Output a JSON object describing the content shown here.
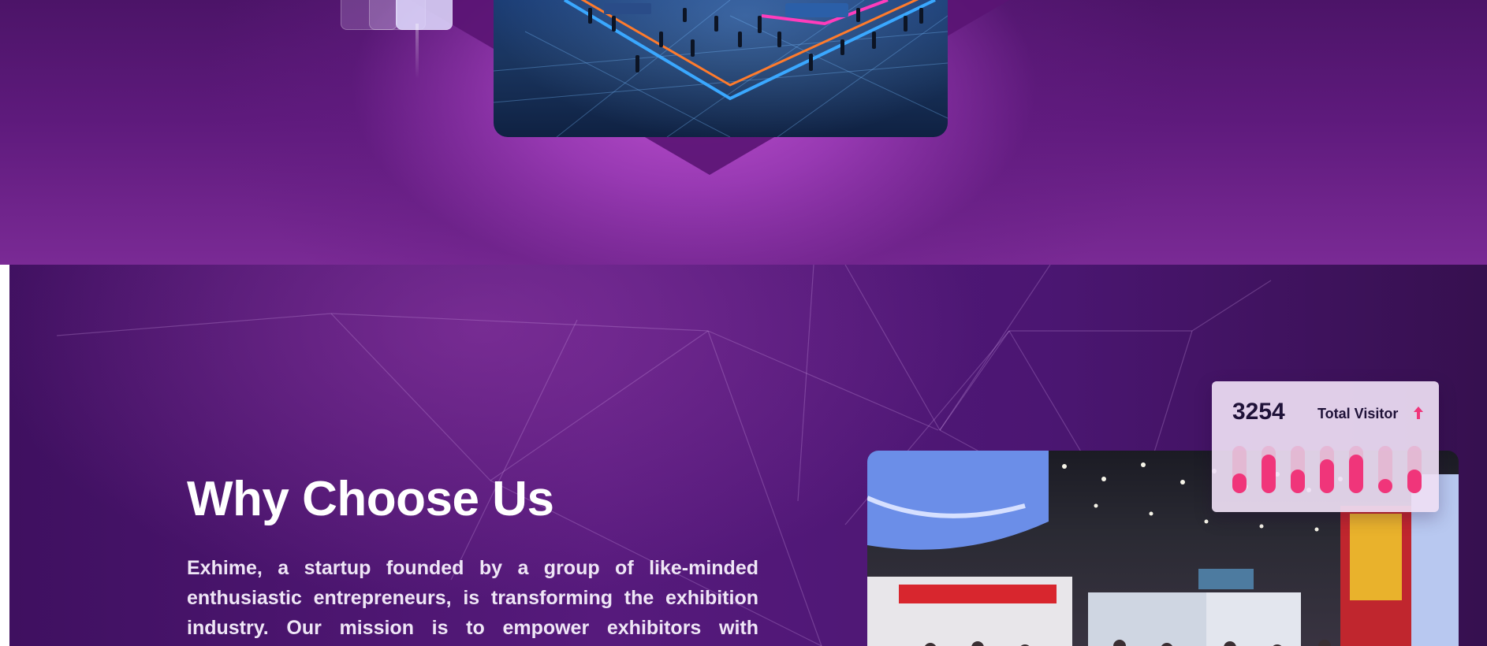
{
  "why": {
    "heading": "Why Choose Us",
    "paragraph": "Exhime, a startup founded by a group of like-minded enthusiastic entrepreneurs, is transforming the exhibition industry. Our mission is to empower exhibitors with"
  },
  "stats": {
    "count": "3254",
    "label": "Total Visitor",
    "trend_icon": "arrow-up-icon",
    "bar_levels": [
      0.42,
      0.82,
      0.5,
      0.72,
      0.82,
      0.3,
      0.5
    ]
  },
  "colors": {
    "accent_pink": "#f0357a",
    "deep_purple": "#3f1060",
    "hero_magenta": "#c454d6"
  }
}
